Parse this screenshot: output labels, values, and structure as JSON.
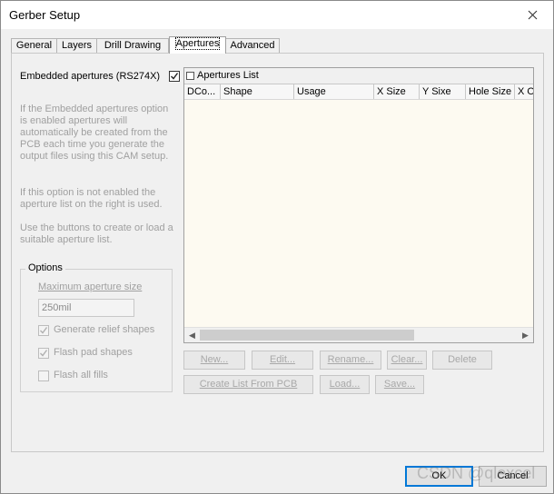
{
  "window": {
    "title": "Gerber Setup"
  },
  "tabs": [
    {
      "label": "General"
    },
    {
      "label": "Layers"
    },
    {
      "label": "Drill Drawing"
    },
    {
      "label": "Apertures"
    },
    {
      "label": "Advanced"
    }
  ],
  "active_tab": "Apertures",
  "embedded": {
    "label": "Embedded apertures (RS274X)",
    "checked": true
  },
  "help": {
    "para1": "If the Embedded apertures option is enabled apertures will automatically be created from the PCB each time you generate the output files using this CAM setup.",
    "para2": "If this option is not enabled the aperture list on the right is used.",
    "para3": "Use the buttons to create or load a suitable aperture list."
  },
  "options": {
    "legend": "Options",
    "max_size_label": "Maximum aperture size",
    "max_size_value": "250mil",
    "relief_label": "Generate relief shapes",
    "relief_checked": true,
    "flash_pad_label": "Flash pad shapes",
    "flash_pad_checked": true,
    "flash_fills_label": "Flash all fills",
    "flash_fills_checked": false
  },
  "apertures_list": {
    "title": "Apertures List",
    "columns": [
      "DCo...",
      "Shape",
      "Usage",
      "X Size",
      "Y Sixe",
      "Hole Size",
      "X O"
    ]
  },
  "buttons": {
    "new": "New...",
    "edit": "Edit...",
    "rename": "Rename...",
    "clear": "Clear...",
    "delete": "Delete",
    "create": "Create List From PCB",
    "load": "Load...",
    "save": "Save..."
  },
  "footer": {
    "ok": "OK",
    "cancel": "Cancel"
  },
  "watermark": "CSDN @qlexcel",
  "colors": {
    "accent": "#0078d7",
    "list_background": "#fdfaf1",
    "disabled_text": "#a0a0a0"
  }
}
